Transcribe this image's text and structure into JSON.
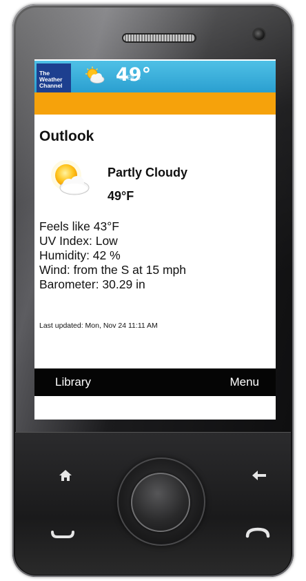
{
  "header": {
    "logo_line1": "The",
    "logo_line2": "Weather",
    "logo_line3": "Channel",
    "temperature": "49°",
    "icon": "partly-cloudy-icon"
  },
  "outlook": {
    "title": "Outlook",
    "condition": "Partly Cloudy",
    "temperature": "49°F",
    "icon": "partly-cloudy-icon"
  },
  "details": {
    "feels_like": "Feels like 43°F",
    "uv_index": "UV Index: Low",
    "humidity": "Humidity: 42 %",
    "wind": "Wind: from the S at 15 mph",
    "barometer": "Barometer: 30.29 in"
  },
  "last_updated": "Last updated: Mon, Nov 24 11:11 AM",
  "softkeys": {
    "left": "Library",
    "right": "Menu"
  },
  "colors": {
    "header_blue": "#2a9fd0",
    "orange_bar": "#f6a20b",
    "logo_blue": "#1d3f8f"
  }
}
